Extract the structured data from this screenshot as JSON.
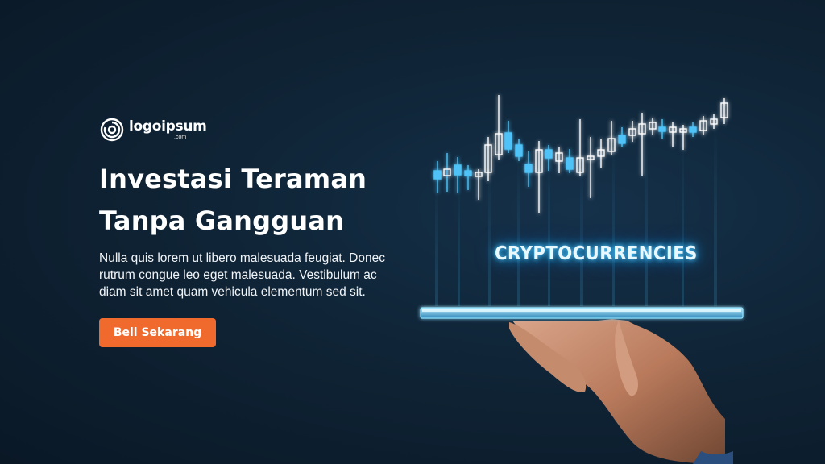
{
  "brand": {
    "name": "logoipsum",
    "suffix": ".com",
    "icon": "logo-ring-icon"
  },
  "hero": {
    "title_line1": "Investasi Teraman",
    "title_line2": "Tanpa Gangguan",
    "description": "Nulla quis lorem ut libero malesuada feugiat. Donec rutrum congue leo eget malesuada. Vestibulum ac diam sit amet quam vehicula elementum sed sit.",
    "cta_label": "Beli Sekarang"
  },
  "illustration": {
    "label": "CRYPTOCURRENCIES",
    "icons": [
      "candlestick-chart-icon",
      "tablet-icon",
      "hand-icon"
    ]
  },
  "colors": {
    "background": "#0f2436",
    "accent": "#ef6a2c",
    "glow": "#4fc3f7",
    "text": "#ffffff"
  }
}
